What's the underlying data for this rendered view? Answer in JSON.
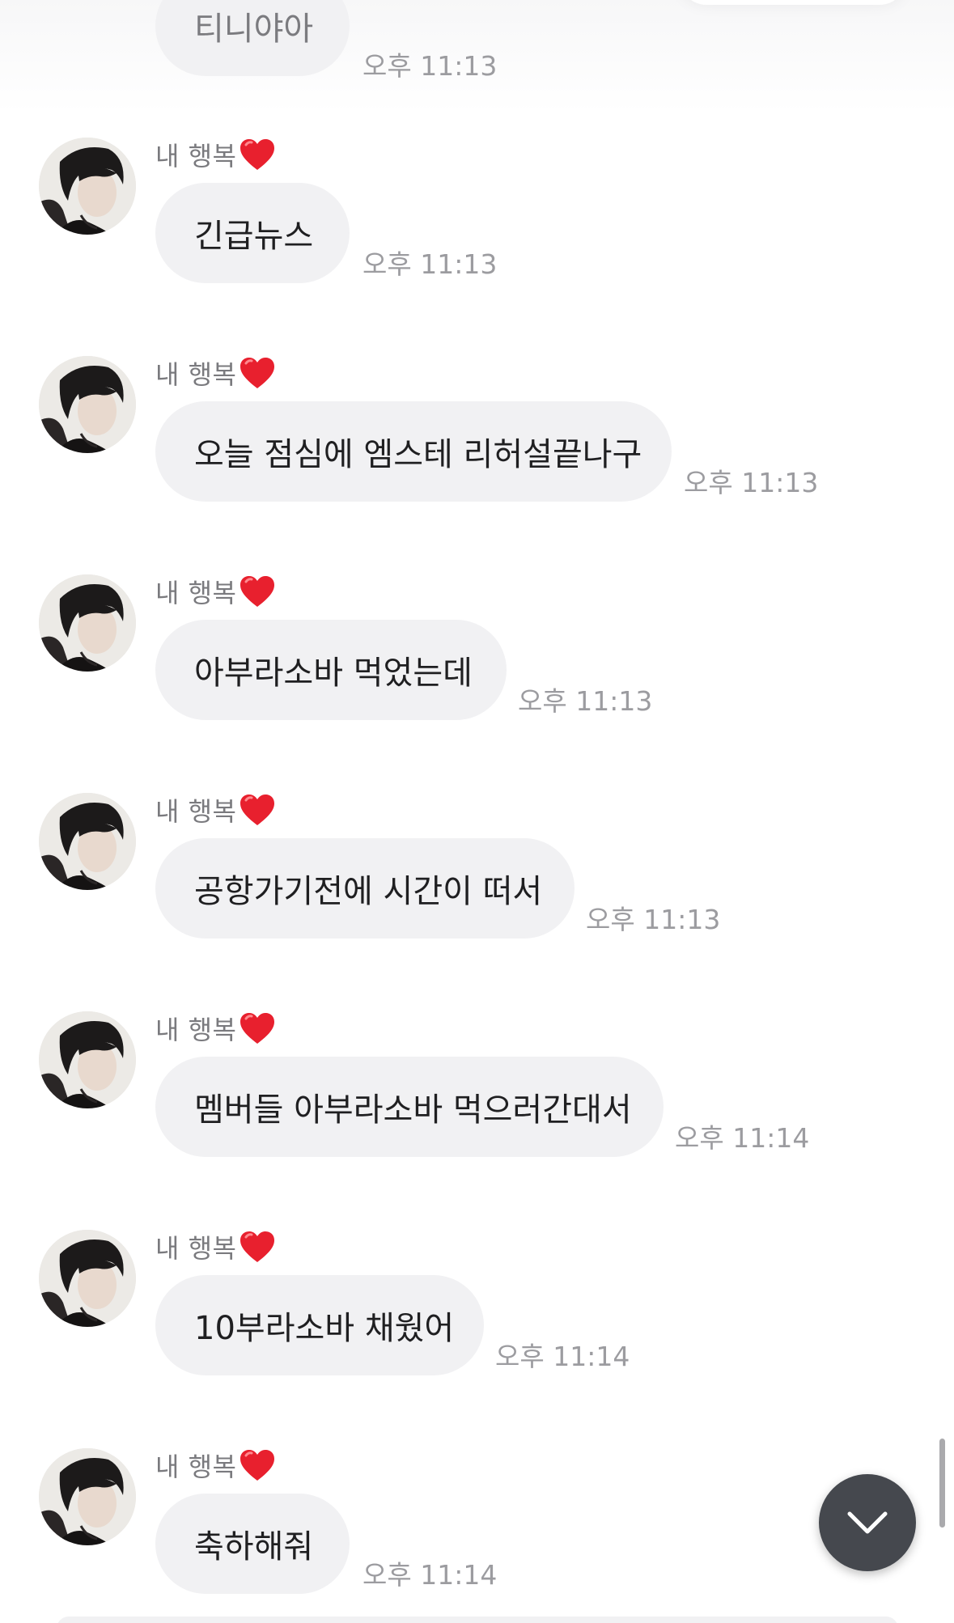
{
  "top_message": {
    "text": "티니야아",
    "time": "오후 11:13"
  },
  "messages": [
    {
      "sender": "내 행복",
      "text": "긴급뉴스",
      "time": "오후 11:13"
    },
    {
      "sender": "내 행복",
      "text": "오늘 점심에 엠스테 리허설끝나구",
      "time": "오후 11:13"
    },
    {
      "sender": "내 행복",
      "text": "아부라소바 먹었는데",
      "time": "오후 11:13"
    },
    {
      "sender": "내 행복",
      "text": "공항가기전에 시간이 떠서",
      "time": "오후 11:13"
    },
    {
      "sender": "내 행복",
      "text": "멤버들 아부라소바 먹으러간대서",
      "time": "오후 11:14"
    },
    {
      "sender": "내 행복",
      "text": "10부라소바 채웠어",
      "time": "오후 11:14"
    },
    {
      "sender": "내 행복",
      "text": "축하해줘",
      "time": "오후 11:14"
    }
  ],
  "icons": {
    "sender_badge": "red-heart-icon",
    "scroll_button": "chevron-down-icon"
  },
  "colors": {
    "bubble": "#f1f1f3",
    "text": "#1f1f21",
    "muted": "#9c9ca0",
    "heart": "#e8202e",
    "scroll_button": "#45484e"
  }
}
